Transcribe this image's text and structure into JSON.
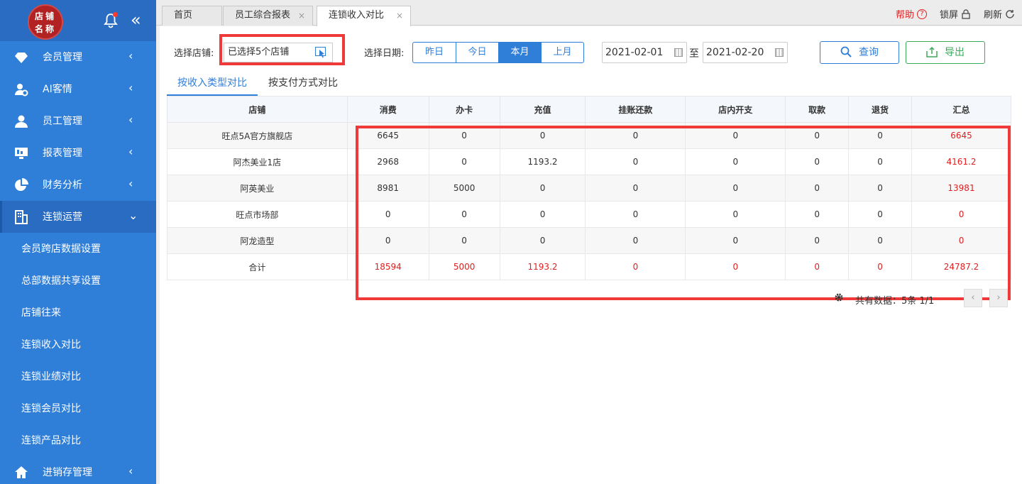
{
  "logo": {
    "line1": "店铺",
    "line2": "名称"
  },
  "sidebar": {
    "items": [
      {
        "label": "会员管理",
        "icon": "diamond-icon",
        "arrow": "‹"
      },
      {
        "label": "AI客情",
        "icon": "user-gear-icon",
        "arrow": "‹"
      },
      {
        "label": "员工管理",
        "icon": "person-icon",
        "arrow": "‹"
      },
      {
        "label": "报表管理",
        "icon": "monitor-icon",
        "arrow": "‹"
      },
      {
        "label": "财务分析",
        "icon": "pie-icon",
        "arrow": "‹"
      },
      {
        "label": "连锁运营",
        "icon": "building-icon",
        "arrow": "⌄"
      }
    ],
    "sub_items": [
      "会员跨店数据设置",
      "总部数据共享设置",
      "店铺往来",
      "连锁收入对比",
      "连锁业绩对比",
      "连锁会员对比",
      "连锁产品对比"
    ],
    "bottom_item": {
      "label": "进销存管理",
      "icon": "home-icon",
      "arrow": "‹"
    }
  },
  "tabs": [
    {
      "label": "首页"
    },
    {
      "label": "员工综合报表",
      "close": "×"
    },
    {
      "label": "连锁收入对比",
      "close": "×"
    }
  ],
  "topbar": {
    "help": "帮助",
    "help_icon": "?",
    "lock": "锁屏",
    "refresh": "刷新"
  },
  "filters": {
    "store_label": "选择店铺:",
    "store_value": "已选择5个店铺",
    "date_label": "选择日期:",
    "date_buttons": [
      "昨日",
      "今日",
      "本月",
      "上月"
    ],
    "date_from": "2021-02-01",
    "date_to": "2021-02-20",
    "to_label": "至",
    "query": "查询",
    "export": "导出"
  },
  "subtabs": [
    "按收入类型对比",
    "按支付方式对比"
  ],
  "table": {
    "headers": [
      "店铺",
      "消费",
      "办卡",
      "充值",
      "挂账还款",
      "店内开支",
      "取款",
      "退货",
      "汇总"
    ],
    "rows": [
      [
        "旺点5A官方旗舰店",
        "6645",
        "0",
        "0",
        "0",
        "0",
        "0",
        "0",
        "6645"
      ],
      [
        "阿杰美业1店",
        "2968",
        "0",
        "1193.2",
        "0",
        "0",
        "0",
        "0",
        "4161.2"
      ],
      [
        "阿英美业",
        "8981",
        "5000",
        "0",
        "0",
        "0",
        "0",
        "0",
        "13981"
      ],
      [
        "旺点市场部",
        "0",
        "0",
        "0",
        "0",
        "0",
        "0",
        "0",
        "0"
      ],
      [
        "阿龙造型",
        "0",
        "0",
        "0",
        "0",
        "0",
        "0",
        "0",
        "0"
      ],
      [
        "合计",
        "18594",
        "5000",
        "1193.2",
        "0",
        "0",
        "0",
        "0",
        "24787.2"
      ]
    ]
  },
  "pager": {
    "text": "共有数据：5条 1/1",
    "prev": "‹",
    "next": "›"
  },
  "colors": {
    "sidebar": "#2f7ed8",
    "accent": "#2f7ed8",
    "red": "#e02020",
    "green": "#3aaa5a",
    "highlight": "#f03a3a"
  }
}
